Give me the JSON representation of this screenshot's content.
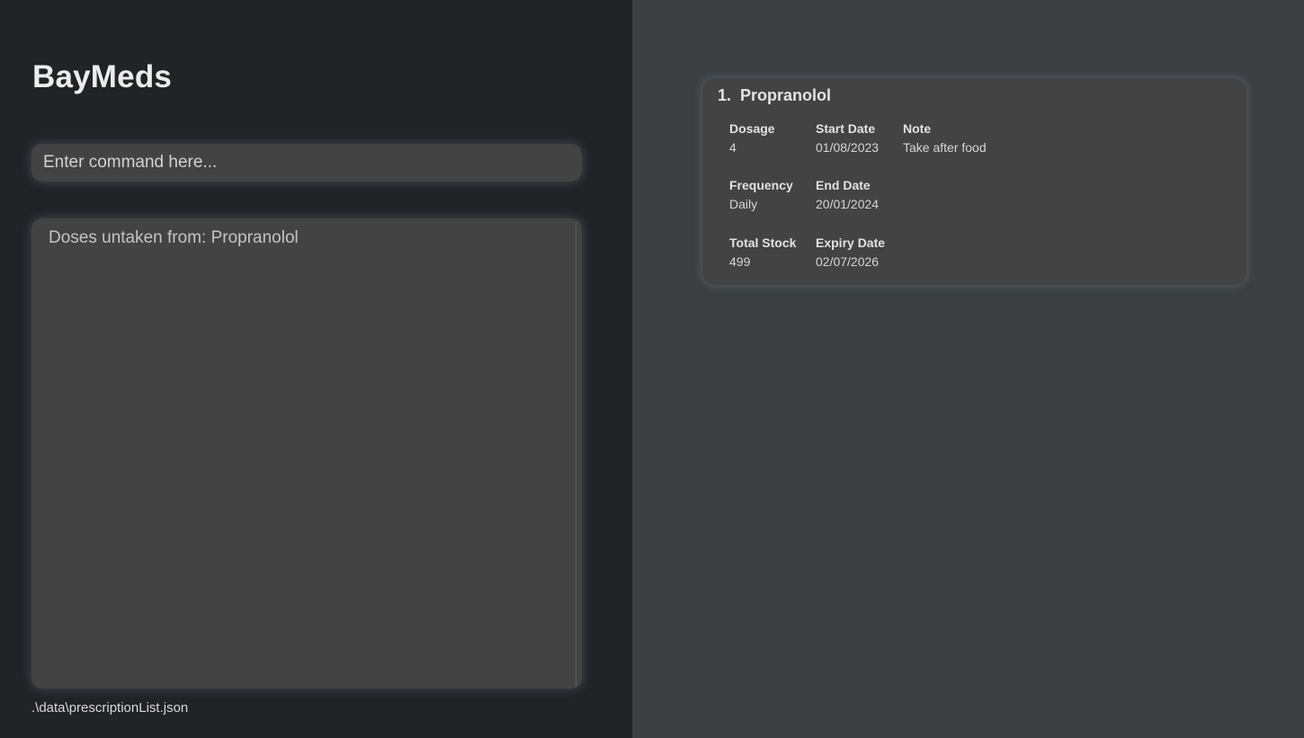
{
  "app": {
    "title": "BayMeds"
  },
  "command": {
    "placeholder": "Enter command here...",
    "value": ""
  },
  "result": {
    "message": "Doses untaken from: Propranolol"
  },
  "status": {
    "file_path": ".\\data\\prescriptionList.json"
  },
  "prescriptions": [
    {
      "title": "1.  Propranolol",
      "dosage_label": "Dosage",
      "dosage": "4",
      "start_date_label": "Start Date",
      "start_date": "01/08/2023",
      "note_label": "Note",
      "note": "Take after food",
      "frequency_label": "Frequency",
      "frequency": "Daily",
      "end_date_label": "End Date",
      "end_date": "20/01/2024",
      "total_stock_label": "Total Stock",
      "total_stock": "499",
      "expiry_date_label": "Expiry Date",
      "expiry_date": "02/07/2026"
    }
  ],
  "colors": {
    "left_background": "#212327",
    "right_background": "#3c4043",
    "panel": "#434343",
    "text": "#e3e3e3"
  }
}
